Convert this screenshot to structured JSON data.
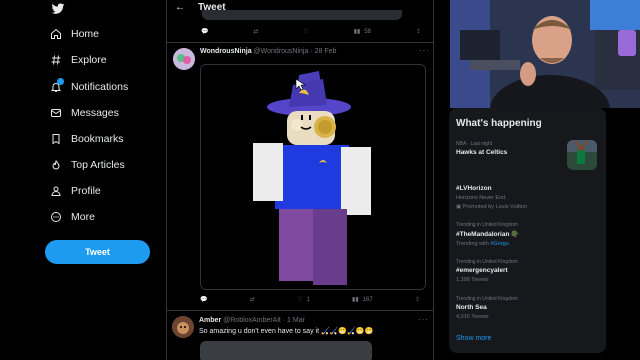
{
  "nav": {
    "items": [
      {
        "label": "Home",
        "icon": "home-icon"
      },
      {
        "label": "Explore",
        "icon": "hashtag-icon"
      },
      {
        "label": "Notifications",
        "icon": "bell-icon"
      },
      {
        "label": "Messages",
        "icon": "envelope-icon"
      },
      {
        "label": "Bookmarks",
        "icon": "bookmark-icon"
      },
      {
        "label": "Top Articles",
        "icon": "flame-icon"
      },
      {
        "label": "Profile",
        "icon": "person-icon"
      },
      {
        "label": "More",
        "icon": "more-circle-icon"
      }
    ],
    "tweet_button": "Tweet"
  },
  "header": {
    "title": "Tweet"
  },
  "prev_tweet": {
    "likes": "",
    "views": "58"
  },
  "tweet": {
    "name": "WondrousNinja",
    "handle": "@WondrousNinja",
    "date": "· 28 Feb",
    "replies": "",
    "retweets": "",
    "likes": "1",
    "views": "167"
  },
  "reply": {
    "name": "Amber",
    "handle": "@RobloxAmberAlt",
    "date": "· 1 Mar",
    "text": "So amazing u don't even have to say it 🏑🏑😁🏑😁😁"
  },
  "trends": {
    "title": "What's happening",
    "items": [
      {
        "meta": "NBA · Last night",
        "name": "Hawks at Celtics",
        "sub": ""
      },
      {
        "meta": "",
        "name": "#LVHorizon",
        "sub": "Horizons Never End.",
        "promo": "Promoted by Louis Vuitton"
      },
      {
        "meta": "Trending in United Kingdom",
        "name": "#TheMandalorian 🪖",
        "sub_prefix": "Trending with ",
        "sub_hl": "#Grogu"
      },
      {
        "meta": "Trending in United Kingdom",
        "name": "#emergencyalert",
        "sub": "1,398 Tweets"
      },
      {
        "meta": "Trending in United Kingdom",
        "name": "North Sea",
        "sub": "4,016 Tweets"
      }
    ],
    "show_more": "Show more"
  },
  "colors": {
    "accent": "#1d9bf0",
    "background": "#000000",
    "card": "#16181c",
    "muted": "#71767b"
  }
}
